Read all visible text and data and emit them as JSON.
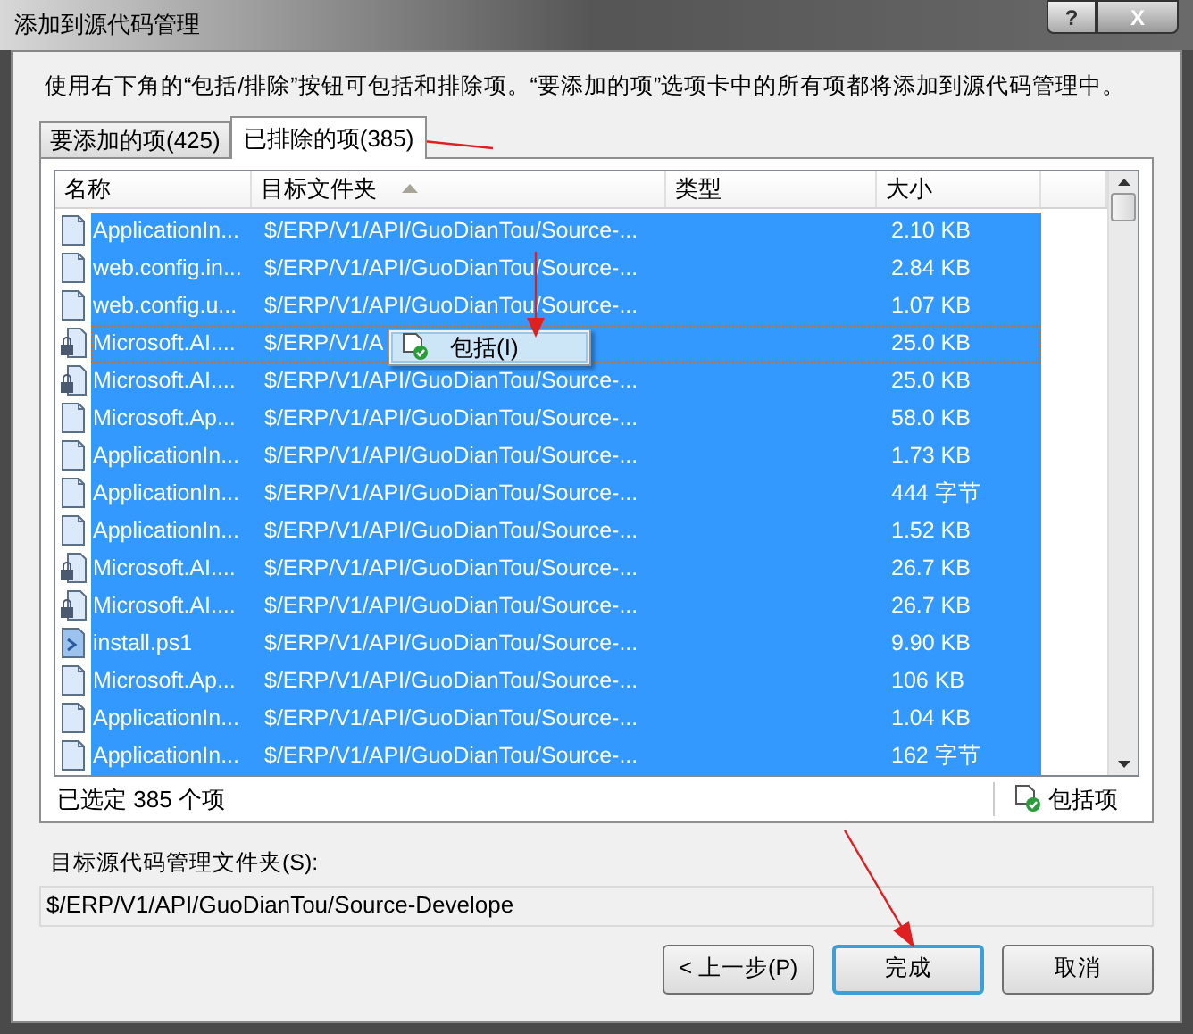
{
  "window": {
    "title": "添加到源代码管理",
    "help": "?",
    "close": "X"
  },
  "instructions": "使用右下角的“包括/排除”按钮可包括和排除项。“要添加的项”选项卡中的所有项都将添加到源代码管理中。",
  "tabs": [
    {
      "label": "要添加的项(425)",
      "selected": false
    },
    {
      "label": "已排除的项(385)",
      "selected": true
    }
  ],
  "table": {
    "columns": [
      {
        "label": "名称",
        "sorted": false
      },
      {
        "label": "目标文件夹",
        "sorted": true
      },
      {
        "label": "类型",
        "sorted": false
      },
      {
        "label": "大小",
        "sorted": false
      }
    ],
    "rows": [
      {
        "kind": "file",
        "name": "ApplicationIn...",
        "folder": "$/ERP/V1/API/GuoDianTou/Source-...",
        "size": "2.10 KB",
        "selected": true,
        "focused": false
      },
      {
        "kind": "file",
        "name": "web.config.in...",
        "folder": "$/ERP/V1/API/GuoDianTou/Source-...",
        "size": "2.84 KB",
        "selected": true,
        "focused": false
      },
      {
        "kind": "file",
        "name": "web.config.u...",
        "folder": "$/ERP/V1/API/GuoDianTou/Source-...",
        "size": "1.07 KB",
        "selected": true,
        "focused": false
      },
      {
        "kind": "locked",
        "name": "Microsoft.AI....",
        "folder": "$/ERP/V1/A",
        "size": "25.0 KB",
        "selected": true,
        "focused": true
      },
      {
        "kind": "locked",
        "name": "Microsoft.AI....",
        "folder": "$/ERP/V1/API/GuoDianTou/Source-...",
        "size": "25.0 KB",
        "selected": true,
        "focused": false
      },
      {
        "kind": "file",
        "name": "Microsoft.Ap...",
        "folder": "$/ERP/V1/API/GuoDianTou/Source-...",
        "size": "58.0 KB",
        "selected": true,
        "focused": false
      },
      {
        "kind": "file",
        "name": "ApplicationIn...",
        "folder": "$/ERP/V1/API/GuoDianTou/Source-...",
        "size": "1.73 KB",
        "selected": true,
        "focused": false
      },
      {
        "kind": "file",
        "name": "ApplicationIn...",
        "folder": "$/ERP/V1/API/GuoDianTou/Source-...",
        "size": "444 字节",
        "selected": true,
        "focused": false
      },
      {
        "kind": "file",
        "name": "ApplicationIn...",
        "folder": "$/ERP/V1/API/GuoDianTou/Source-...",
        "size": "1.52 KB",
        "selected": true,
        "focused": false
      },
      {
        "kind": "locked",
        "name": "Microsoft.AI....",
        "folder": "$/ERP/V1/API/GuoDianTou/Source-...",
        "size": "26.7 KB",
        "selected": true,
        "focused": false
      },
      {
        "kind": "locked",
        "name": "Microsoft.AI....",
        "folder": "$/ERP/V1/API/GuoDianTou/Source-...",
        "size": "26.7 KB",
        "selected": true,
        "focused": false
      },
      {
        "kind": "script",
        "name": "install.ps1",
        "folder": "$/ERP/V1/API/GuoDianTou/Source-...",
        "size": "9.90 KB",
        "selected": true,
        "focused": false
      },
      {
        "kind": "file",
        "name": "Microsoft.Ap...",
        "folder": "$/ERP/V1/API/GuoDianTou/Source-...",
        "size": "106 KB",
        "selected": true,
        "focused": false
      },
      {
        "kind": "file",
        "name": "ApplicationIn...",
        "folder": "$/ERP/V1/API/GuoDianTou/Source-...",
        "size": "1.04 KB",
        "selected": true,
        "focused": false
      },
      {
        "kind": "file",
        "name": "ApplicationIn...",
        "folder": "$/ERP/V1/API/GuoDianTou/Source-...",
        "size": "162 字节",
        "selected": true,
        "focused": false
      }
    ]
  },
  "context_menu": {
    "items": [
      {
        "label": "包括(I)"
      }
    ]
  },
  "selection_count": "已选定 385 个项",
  "include_button": "包括项",
  "target": {
    "label": "目标源代码管理文件夹(S):",
    "value": "$/ERP/V1/API/GuoDianTou/Source-Develope"
  },
  "buttons": [
    {
      "label": "< 上一步(P)",
      "default": false
    },
    {
      "label": "完成",
      "default": true
    },
    {
      "label": "取消",
      "default": false
    }
  ]
}
